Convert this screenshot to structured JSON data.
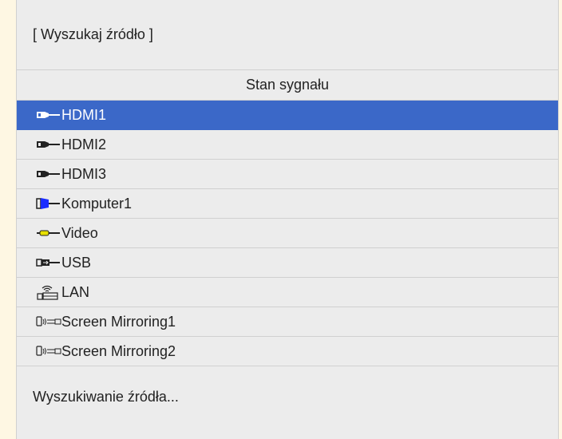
{
  "header": {
    "title": "[ Wyszukaj źródło ]"
  },
  "column_header": {
    "label": "Stan sygnału"
  },
  "sources": [
    {
      "label": "HDMI1",
      "icon": "hdmi-icon",
      "selected": true
    },
    {
      "label": "HDMI2",
      "icon": "hdmi-icon",
      "selected": false
    },
    {
      "label": "HDMI3",
      "icon": "hdmi-icon",
      "selected": false
    },
    {
      "label": "Komputer1",
      "icon": "vga-computer-icon",
      "selected": false
    },
    {
      "label": "Video",
      "icon": "video-rca-icon",
      "selected": false
    },
    {
      "label": "USB",
      "icon": "usb-icon",
      "selected": false
    },
    {
      "label": "LAN",
      "icon": "lan-icon",
      "selected": false
    },
    {
      "label": "Screen Mirroring1",
      "icon": "screen-mirroring-icon",
      "selected": false
    },
    {
      "label": "Screen Mirroring2",
      "icon": "screen-mirroring-icon",
      "selected": false
    }
  ],
  "footer": {
    "status": "Wyszukiwanie źródła..."
  },
  "colors": {
    "background": "#fef7e3",
    "panel": "#ececec",
    "selected": "#3b68c8",
    "vga_blue": "#1a2cff",
    "video_yellow": "#e8e000"
  }
}
